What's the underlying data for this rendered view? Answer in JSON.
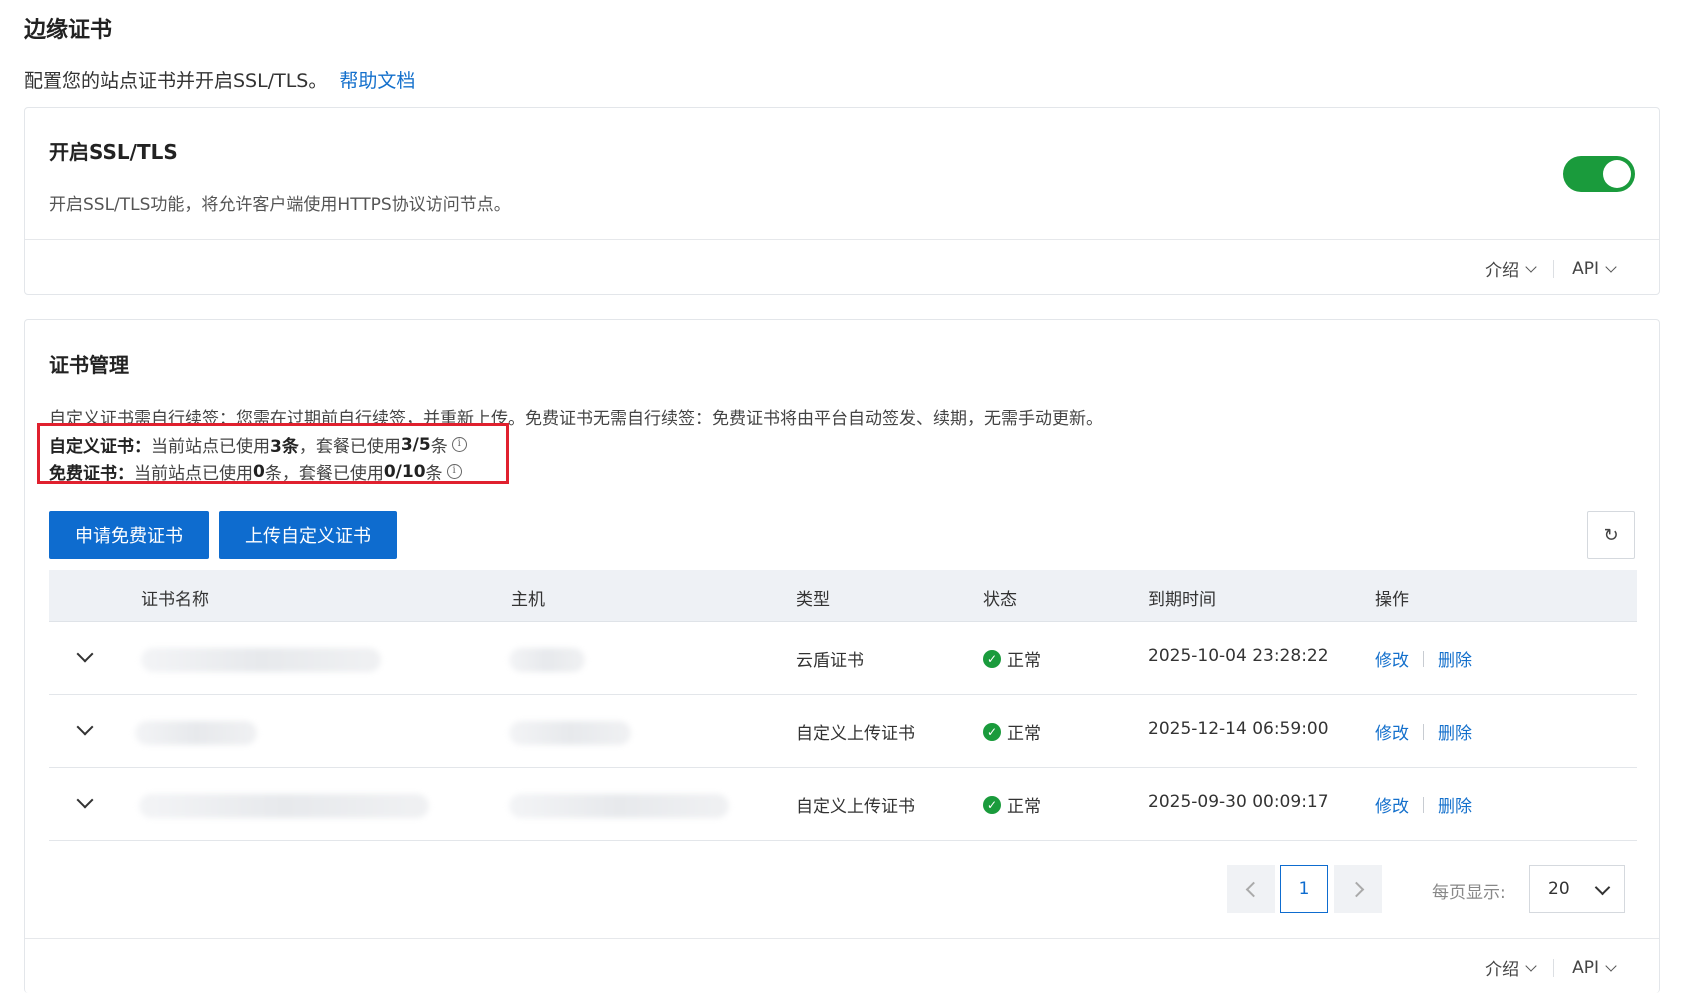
{
  "page": {
    "title": "边缘证书",
    "description": "配置您的站点证书并开启SSL/TLS。",
    "help_link": "帮助文档"
  },
  "ssl_card": {
    "title": "开启SSL/TLS",
    "description": "开启SSL/TLS功能，将允许客户端使用HTTPS协议访问节点。",
    "toggle_on": true,
    "footer": {
      "intro": "介绍",
      "api": "API"
    }
  },
  "cert_card": {
    "title": "证书管理",
    "note": "自定义证书需自行续签：您需在过期前自行续签，并重新上传。免费证书无需自行续签：免费证书将由平台自动签发、续期，无需手动更新。",
    "quota": {
      "custom_label": "自定义证书：",
      "custom_text_a": "当前站点已使用",
      "custom_used": "3条",
      "custom_text_b": "，套餐已使用",
      "custom_plan": "3/5",
      "custom_text_c": "条",
      "free_label": "免费证书：",
      "free_text_a": "当前站点已使用",
      "free_used": "0",
      "free_text_b": "条，套餐已使用",
      "free_plan": "0/10",
      "free_text_c": "条"
    },
    "buttons": {
      "apply_free": "申请免费证书",
      "upload_custom": "上传自定义证书",
      "refresh_icon": "refresh-icon"
    },
    "table": {
      "headers": [
        "证书名称",
        "主机",
        "类型",
        "状态",
        "到期时间",
        "操作"
      ],
      "rows": [
        {
          "type": "云盾证书",
          "status": "正常",
          "expires": "2025-10-04 23:28:22",
          "edit": "修改",
          "delete": "删除"
        },
        {
          "type": "自定义上传证书",
          "status": "正常",
          "expires": "2025-12-14 06:59:00",
          "edit": "修改",
          "delete": "删除"
        },
        {
          "type": "自定义上传证书",
          "status": "正常",
          "expires": "2025-09-30 00:09:17",
          "edit": "修改",
          "delete": "删除"
        }
      ]
    },
    "pagination": {
      "current_page": "1",
      "per_page_label": "每页显示:",
      "per_page_value": "20"
    },
    "footer": {
      "intro": "介绍",
      "api": "API"
    }
  },
  "colors": {
    "accent": "#0e6ccf",
    "success": "#1a9b3c",
    "highlight": "#e0202e"
  }
}
